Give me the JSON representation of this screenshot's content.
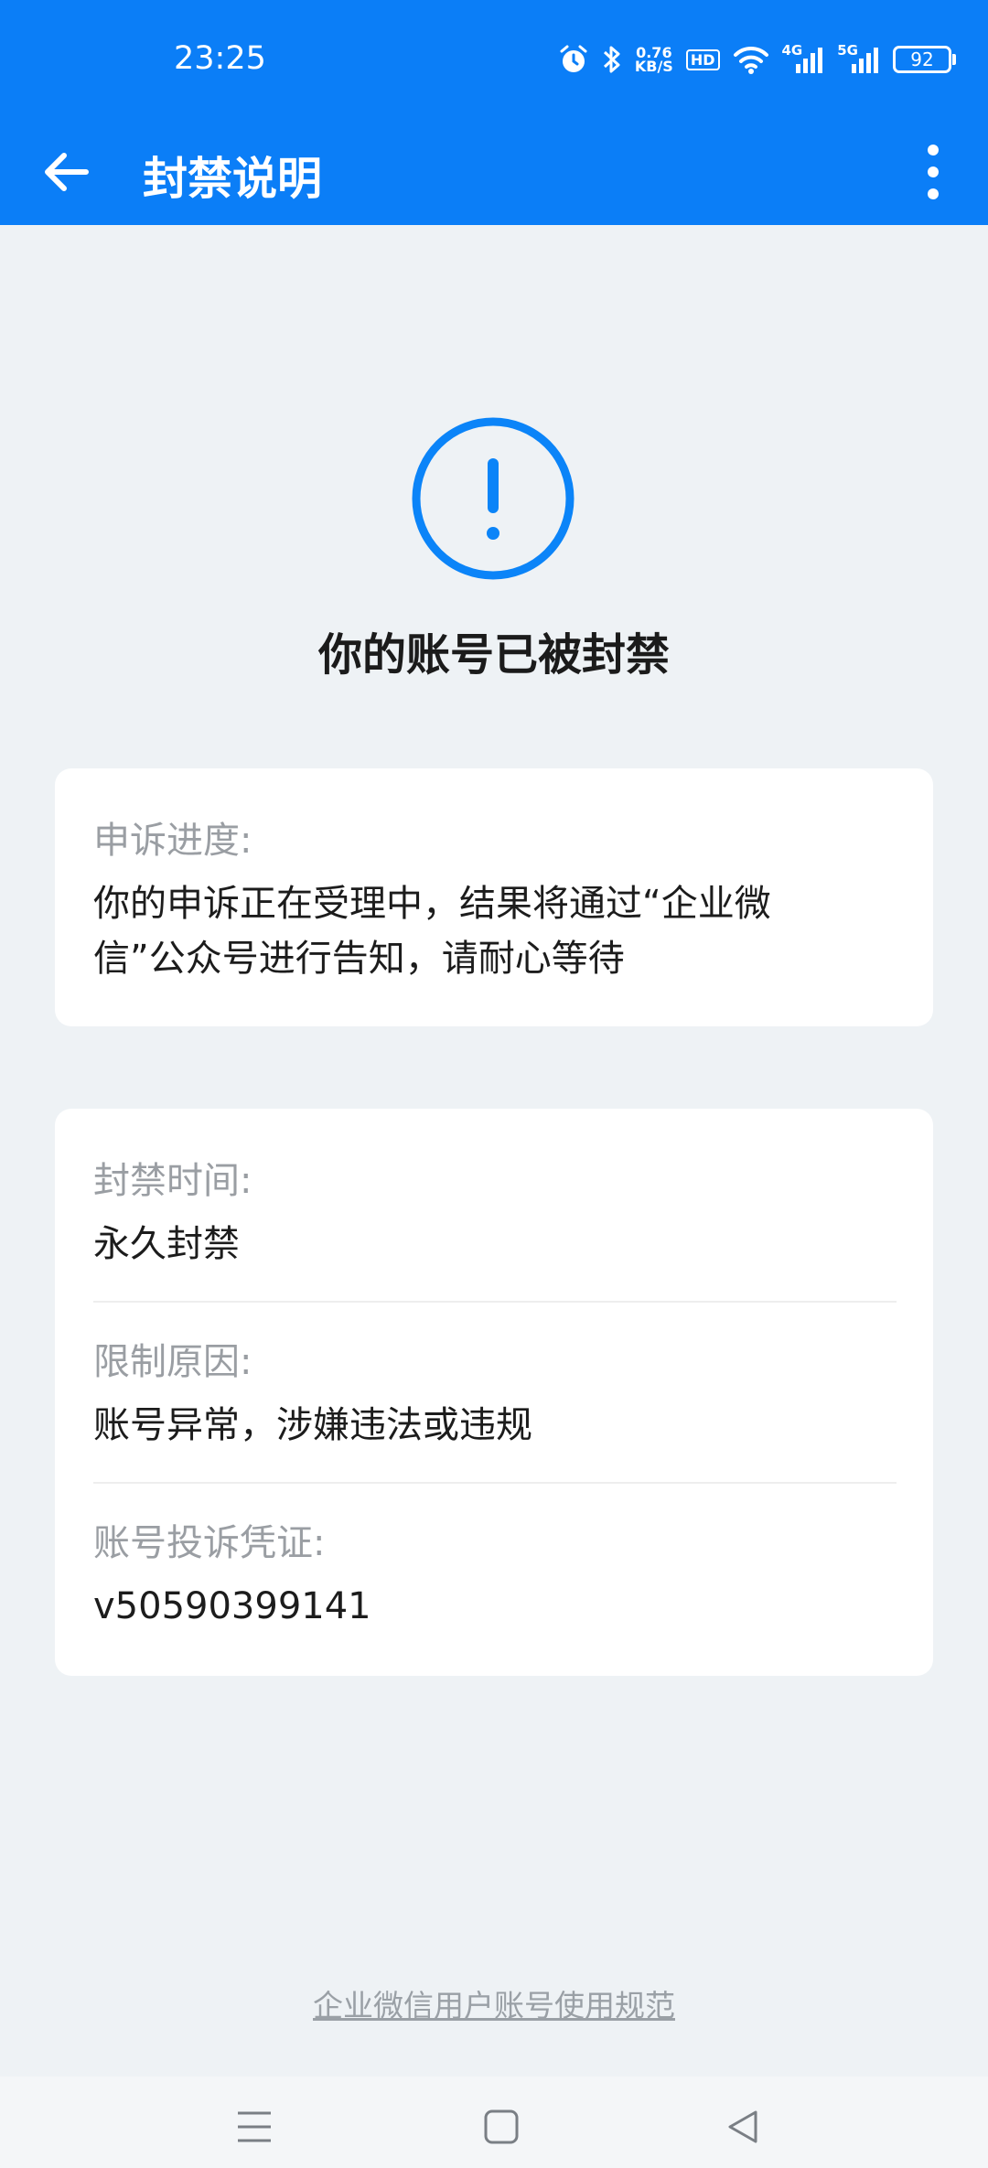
{
  "status_bar": {
    "time": "23:25",
    "net_speed_value": "0.76",
    "net_speed_unit": "KB/S",
    "hd_label": "HD",
    "sig1_label": "4G",
    "sig2_label": "5G",
    "battery": "92"
  },
  "app_bar": {
    "title": "封禁说明"
  },
  "notice": {
    "title": "你的账号已被封禁",
    "accent_color": "#0b84f8"
  },
  "appeal_card": {
    "label": "申诉进度:",
    "value_line1": "你的申诉正在受理中，结果将通过“企业微",
    "value_line2": "信”公众号进行告知，请耐心等待"
  },
  "detail_card": {
    "ban_time_label": "封禁时间:",
    "ban_time_value": "永久封禁",
    "reason_label": "限制原因:",
    "reason_value": "账号异常，涉嫌违法或违规",
    "voucher_label": "账号投诉凭证:",
    "voucher_value": "v50590399141"
  },
  "footer": {
    "link_text": "企业微信用户账号使用规范"
  }
}
